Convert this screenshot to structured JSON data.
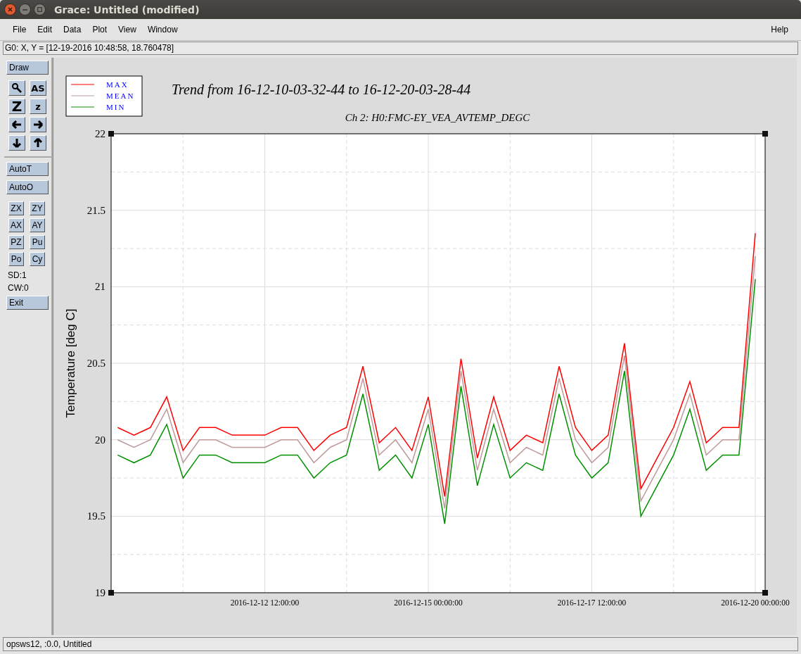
{
  "window": {
    "title": "Grace: Untitled (modified)"
  },
  "menu": {
    "left": [
      {
        "label": "File"
      },
      {
        "label": "Edit"
      },
      {
        "label": "Data"
      },
      {
        "label": "Plot"
      },
      {
        "label": "View"
      },
      {
        "label": "Window"
      }
    ],
    "right": [
      {
        "label": "Help"
      }
    ]
  },
  "locator": "G0: X, Y = [12-19-2016 10:48:58, 18.760478]",
  "toolbar": {
    "draw": "Draw",
    "tools": [
      {
        "kind": "zoom"
      },
      {
        "kind": "text",
        "label": "AS"
      },
      {
        "kind": "big-text",
        "label": "Z"
      },
      {
        "kind": "text",
        "label": "z"
      },
      {
        "kind": "left"
      },
      {
        "kind": "right"
      },
      {
        "kind": "down"
      },
      {
        "kind": "up"
      }
    ],
    "auto": [
      "AutoT",
      "AutoO"
    ],
    "small": [
      "ZX",
      "ZY",
      "AX",
      "AY",
      "PZ",
      "Pu",
      "Po",
      "Cy"
    ],
    "info": [
      "SD:1",
      "CW:0"
    ],
    "exit": "Exit"
  },
  "graph": {
    "title": "Trend from 16-12-10-03-32-44 to 16-12-20-03-28-44",
    "subtitle": "Ch 2: H0:FMC-EY_VEA_AVTEMP_DEGC",
    "chart_data": {
      "type": "line",
      "grid": true,
      "legend": "top-left",
      "ylabel": "Temperature [deg C]",
      "ylim": [
        19,
        22
      ],
      "yticks": [
        19,
        19.5,
        20,
        20.5,
        21,
        21.5,
        22
      ],
      "categories": [
        null,
        null,
        null,
        null,
        null,
        null,
        null,
        null,
        null,
        "2016-12-12 12:00:00",
        null,
        null,
        null,
        null,
        null,
        null,
        null,
        null,
        null,
        "2016-12-15 00:00:00",
        null,
        null,
        null,
        null,
        null,
        null,
        null,
        null,
        null,
        "2016-12-17 12:00:00",
        null,
        null,
        null,
        null,
        null,
        null,
        null,
        null,
        null,
        "2016-12-20 00:00:00"
      ],
      "series": [
        {
          "name": "MAX",
          "color": "#ff0000",
          "values": [
            20.08,
            20.03,
            20.08,
            20.28,
            19.93,
            20.08,
            20.08,
            20.03,
            20.03,
            20.03,
            20.08,
            20.08,
            19.93,
            20.03,
            20.08,
            20.48,
            19.98,
            20.08,
            19.93,
            20.28,
            19.63,
            20.53,
            19.88,
            20.28,
            19.93,
            20.03,
            19.98,
            20.48,
            20.08,
            19.93,
            20.03,
            20.63,
            19.68,
            19.88,
            20.08,
            20.38,
            19.98,
            20.08,
            20.08,
            21.35
          ]
        },
        {
          "name": "MEAN",
          "color": "#c09a9a",
          "values": [
            20.0,
            19.95,
            20.0,
            20.2,
            19.85,
            20.0,
            20.0,
            19.95,
            19.95,
            19.95,
            20.0,
            20.0,
            19.85,
            19.95,
            20.0,
            20.4,
            19.9,
            20.0,
            19.85,
            20.2,
            19.55,
            20.45,
            19.8,
            20.2,
            19.85,
            19.95,
            19.9,
            20.4,
            20.0,
            19.85,
            19.95,
            20.55,
            19.6,
            19.8,
            20.0,
            20.3,
            19.9,
            20.0,
            20.0,
            21.2
          ]
        },
        {
          "name": "MIN",
          "color": "#009000",
          "values": [
            19.9,
            19.85,
            19.9,
            20.1,
            19.75,
            19.9,
            19.9,
            19.85,
            19.85,
            19.85,
            19.9,
            19.9,
            19.75,
            19.85,
            19.9,
            20.3,
            19.8,
            19.9,
            19.75,
            20.1,
            19.45,
            20.35,
            19.7,
            20.1,
            19.75,
            19.85,
            19.8,
            20.3,
            19.9,
            19.75,
            19.85,
            20.45,
            19.5,
            19.7,
            19.9,
            20.2,
            19.8,
            19.9,
            19.9,
            21.05
          ]
        }
      ]
    }
  },
  "status_bar": "opsws12, :0.0, Untitled"
}
